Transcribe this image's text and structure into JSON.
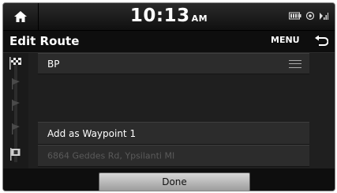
{
  "status": {
    "time": "10:13",
    "ampm": "AM",
    "icons": [
      "battery-icon",
      "navigation-gps-icon",
      "signal-icon"
    ]
  },
  "header": {
    "title": "Edit Route",
    "menu_label": "MENU",
    "back_icon": "back-arrow-icon",
    "home_icon": "home-icon"
  },
  "route": {
    "items": [
      {
        "label": "BP",
        "icon": "checkered-flag-icon"
      },
      {
        "label": "Add as Waypoint 1",
        "icon": "waypoint-flag-icon"
      },
      {
        "label": "6864 Geddes Rd, Ypsilanti MI",
        "icon": "destination-flag-icon"
      }
    ]
  },
  "footer": {
    "done_label": "Done"
  },
  "colors": {
    "background": "#1f1f1f",
    "row": "#2c2c2c",
    "text": "#ffffff",
    "dim_text": "#5a5a5a",
    "button": "#c0c0c0"
  }
}
